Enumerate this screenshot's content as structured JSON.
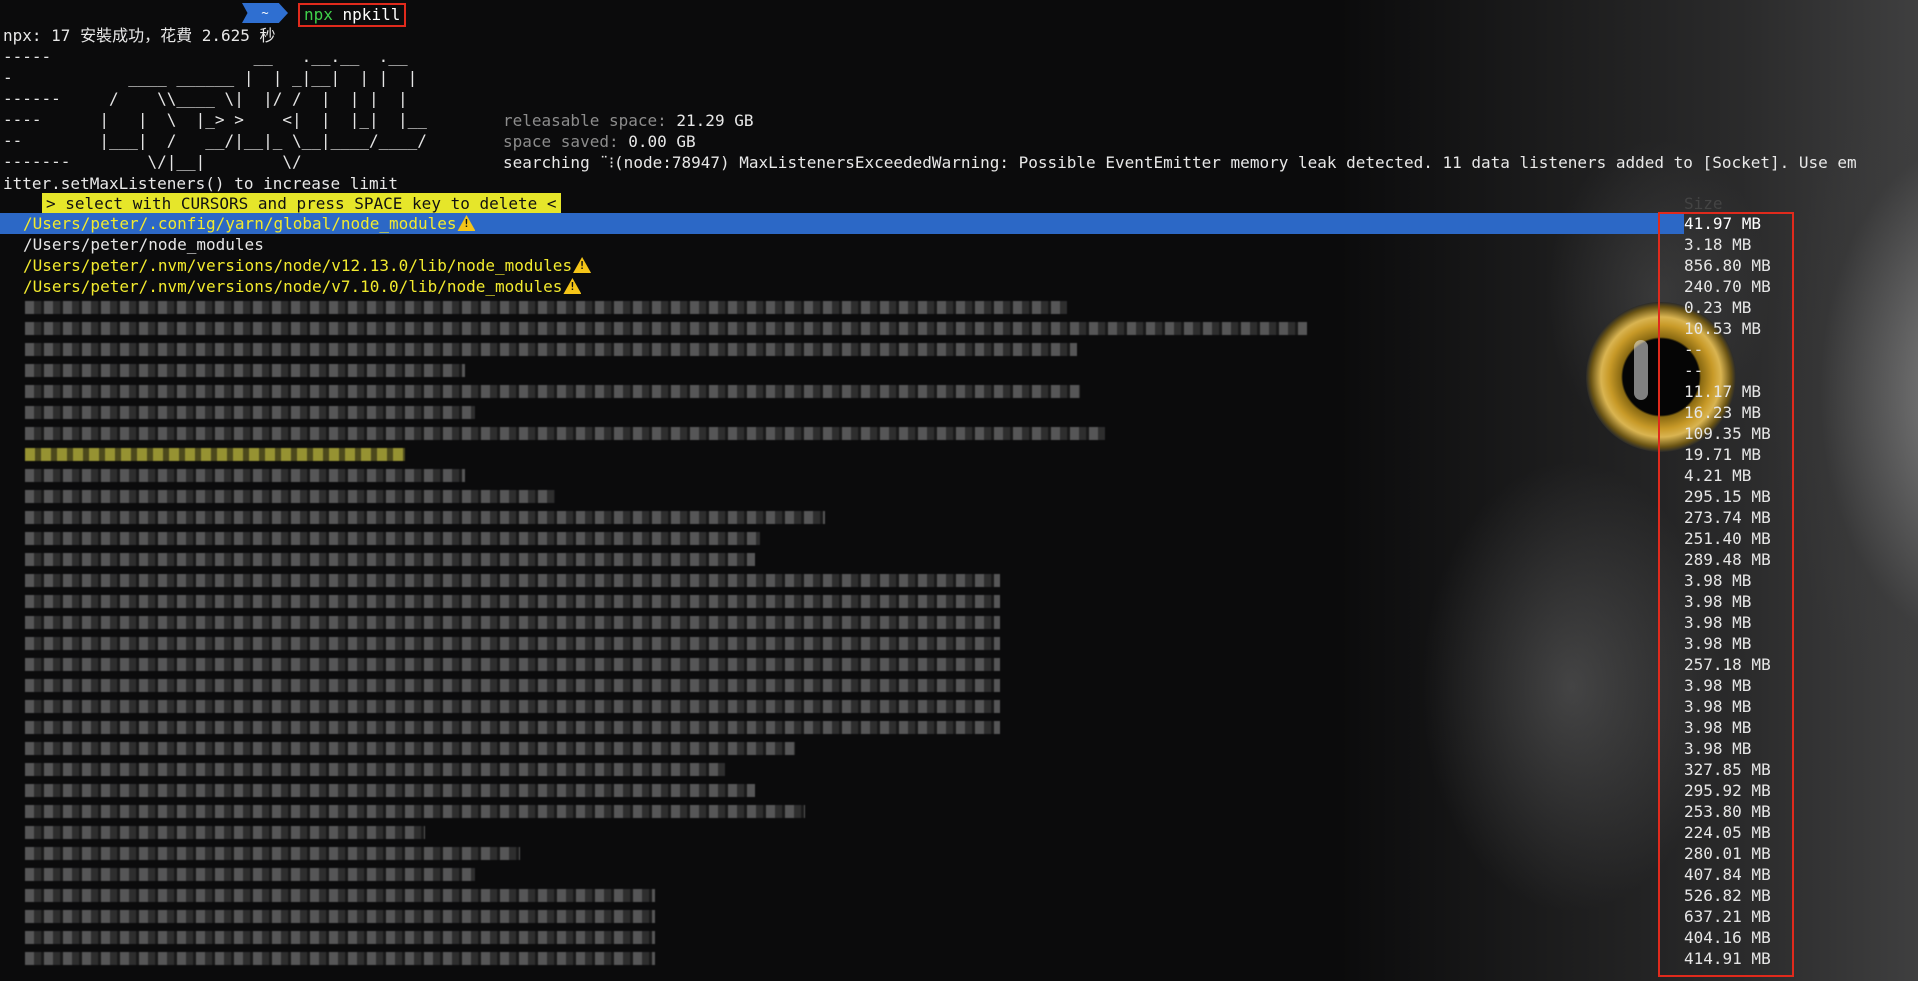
{
  "prompt": {
    "dir_label": "~",
    "cmd_npx": "npx",
    "cmd_rest": " npkill"
  },
  "npx_message": "npx: 17 安裝成功，花費 2.625 秒",
  "ascii_logo": "-----                     __   .__.__  .__\n-            ____ ______ |  | _|__|  | |  |\n------     /    \\\\____ \\|  |/ /  |  | |  |\n----      |   |  \\  |_> >    <|  |  |_|  |__\n--        |___|  /   __/|__|_ \\__|____/____/\n-------        \\/|__|        \\/",
  "stats": {
    "releasable_label": "releasable space:",
    "releasable_value": "21.29 GB",
    "saved_label": "space saved:",
    "saved_value": "0.00 GB"
  },
  "searching_text": "searching ¨⁝(node:78947) MaxListenersExceededWarning: Possible EventEmitter memory leak detected. 11 data listeners added to [Socket]. Use em",
  "warning_continuation": "itter.setMaxListeners() to increase limit",
  "hint": "> select with CURSORS and press SPACE key to delete <",
  "sizes_header": "Size",
  "results": [
    {
      "path": "/Users/peter/.config/yarn/global/node_modules",
      "size": "41.97 MB",
      "warn": true,
      "selected": true,
      "blur": 0
    },
    {
      "path": "/Users/peter/node_modules",
      "size": "3.18 MB",
      "warn": false,
      "selected": false,
      "blur": 0
    },
    {
      "path": "/Users/peter/.nvm/versions/node/v12.13.0/lib/node_modules",
      "size": "856.80 MB",
      "warn": true,
      "selected": false,
      "blur": 0
    },
    {
      "path": "/Users/peter/.nvm/versions/node/v7.10.0/lib/node_modules",
      "size": "240.70 MB",
      "warn": true,
      "selected": false,
      "blur": 0
    },
    {
      "path": "",
      "size": "0.23 MB",
      "blur": 1
    },
    {
      "path": "",
      "size": "10.53 MB",
      "blur": 1
    },
    {
      "path": "",
      "size": "--",
      "blur": 1
    },
    {
      "path": "",
      "size": "--",
      "blur": 1
    },
    {
      "path": "",
      "size": "11.17 MB",
      "blur": 1
    },
    {
      "path": "",
      "size": "16.23 MB",
      "blur": 1
    },
    {
      "path": "",
      "size": "109.35 MB",
      "blur": 1
    },
    {
      "path": "",
      "size": "19.71 MB",
      "blur": 2
    },
    {
      "path": "",
      "size": "4.21 MB",
      "blur": 1
    },
    {
      "path": "",
      "size": "295.15 MB",
      "blur": 1
    },
    {
      "path": "",
      "size": "273.74 MB",
      "blur": 1
    },
    {
      "path": "",
      "size": "251.40 MB",
      "blur": 1
    },
    {
      "path": "",
      "size": "289.48 MB",
      "blur": 1
    },
    {
      "path": "",
      "size": "3.98 MB",
      "blur": 1
    },
    {
      "path": "",
      "size": "3.98 MB",
      "blur": 1
    },
    {
      "path": "",
      "size": "3.98 MB",
      "blur": 1
    },
    {
      "path": "",
      "size": "3.98 MB",
      "blur": 1
    },
    {
      "path": "",
      "size": "257.18 MB",
      "blur": 1
    },
    {
      "path": "",
      "size": "3.98 MB",
      "blur": 1
    },
    {
      "path": "",
      "size": "3.98 MB",
      "blur": 1
    },
    {
      "path": "",
      "size": "3.98 MB",
      "blur": 1
    },
    {
      "path": "",
      "size": "3.98 MB",
      "blur": 1
    },
    {
      "path": "",
      "size": "327.85 MB",
      "blur": 1
    },
    {
      "path": "",
      "size": "295.92 MB",
      "blur": 1
    },
    {
      "path": "",
      "size": "253.80 MB",
      "blur": 1
    },
    {
      "path": "",
      "size": "224.05 MB",
      "blur": 1
    },
    {
      "path": "",
      "size": "280.01 MB",
      "blur": 1
    },
    {
      "path": "",
      "size": "407.84 MB",
      "blur": 1
    },
    {
      "path": "",
      "size": "526.82 MB",
      "blur": 1
    },
    {
      "path": "",
      "size": "637.21 MB",
      "blur": 1
    },
    {
      "path": "",
      "size": "404.16 MB",
      "blur": 1
    },
    {
      "path": "",
      "size": "414.91 MB",
      "blur": 1
    }
  ]
}
